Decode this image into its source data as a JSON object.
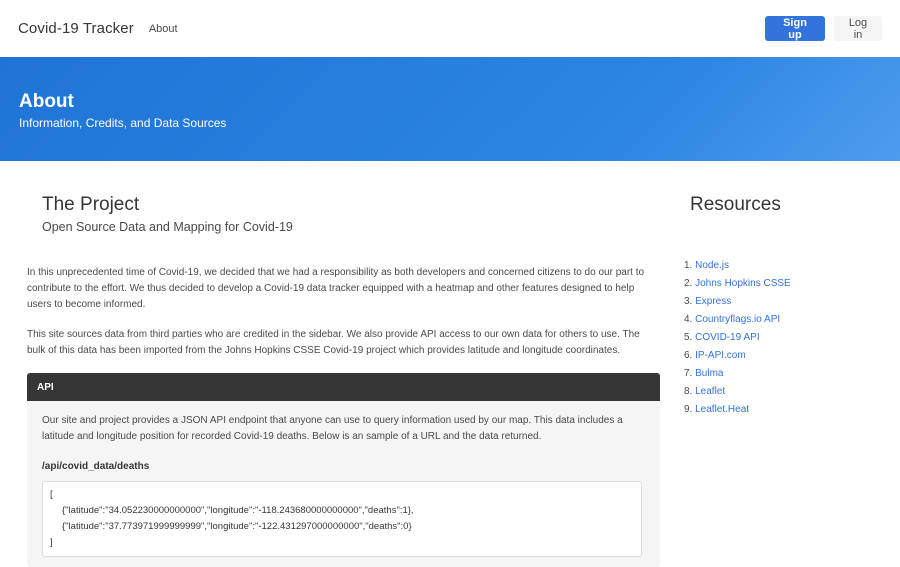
{
  "navbar": {
    "brand": "Covid-19 Tracker",
    "about_link": "About",
    "signup_label": "Sign up",
    "login_label": "Log in"
  },
  "hero": {
    "title": "About",
    "subtitle": "Information, Credits, and Data Sources"
  },
  "project": {
    "title": "The Project",
    "subtitle": "Open Source Data and Mapping for Covid-19",
    "paragraph1": "In this unprecedented time of Covid-19, we decided that we had a responsibility as both developers and concerned citizens to do our part to contribute to the effort. We thus decided to develop a Covid-19 data tracker equipped with a heatmap and other features designed to help users to become informed.",
    "paragraph2": "This site sources data from third parties who are credited in the sidebar. We also provide API access to our own data for others to use. The bulk of this data has been imported from the Johns Hopkins CSSE Covid-19 project which provides latitude and longitude coordinates."
  },
  "api": {
    "header": "API",
    "description": "Our site and project provides a JSON API endpoint that anyone can use to query information used by our map. This data includes a latitude and longitude position for recorded Covid-19 deaths. Below is an sample of a URL and the data returned.",
    "path": "/api/covid_data/deaths",
    "code_lines": [
      "[",
      "{\"latitude\":\"34.052230000000000\",\"longitude\":\"-118.243680000000000\",\"deaths\":1},",
      "{\"latitude\":\"37.773971999999999\",\"longitude\":\"-122.431297000000000\",\"deaths\":0}",
      "]"
    ]
  },
  "resources": {
    "title": "Resources",
    "items": [
      "Node.js",
      "Johns Hopkins CSSE",
      "Express",
      "Countryflags.io API",
      "COVID-19 API",
      "IP-API.com",
      "Bulma",
      "Leaflet",
      "Leaflet.Heat"
    ]
  },
  "colors": {
    "primary": "#3273dc",
    "hero_start": "#1f74d6",
    "hero_end": "#4d9cee",
    "api_header": "#363636"
  }
}
